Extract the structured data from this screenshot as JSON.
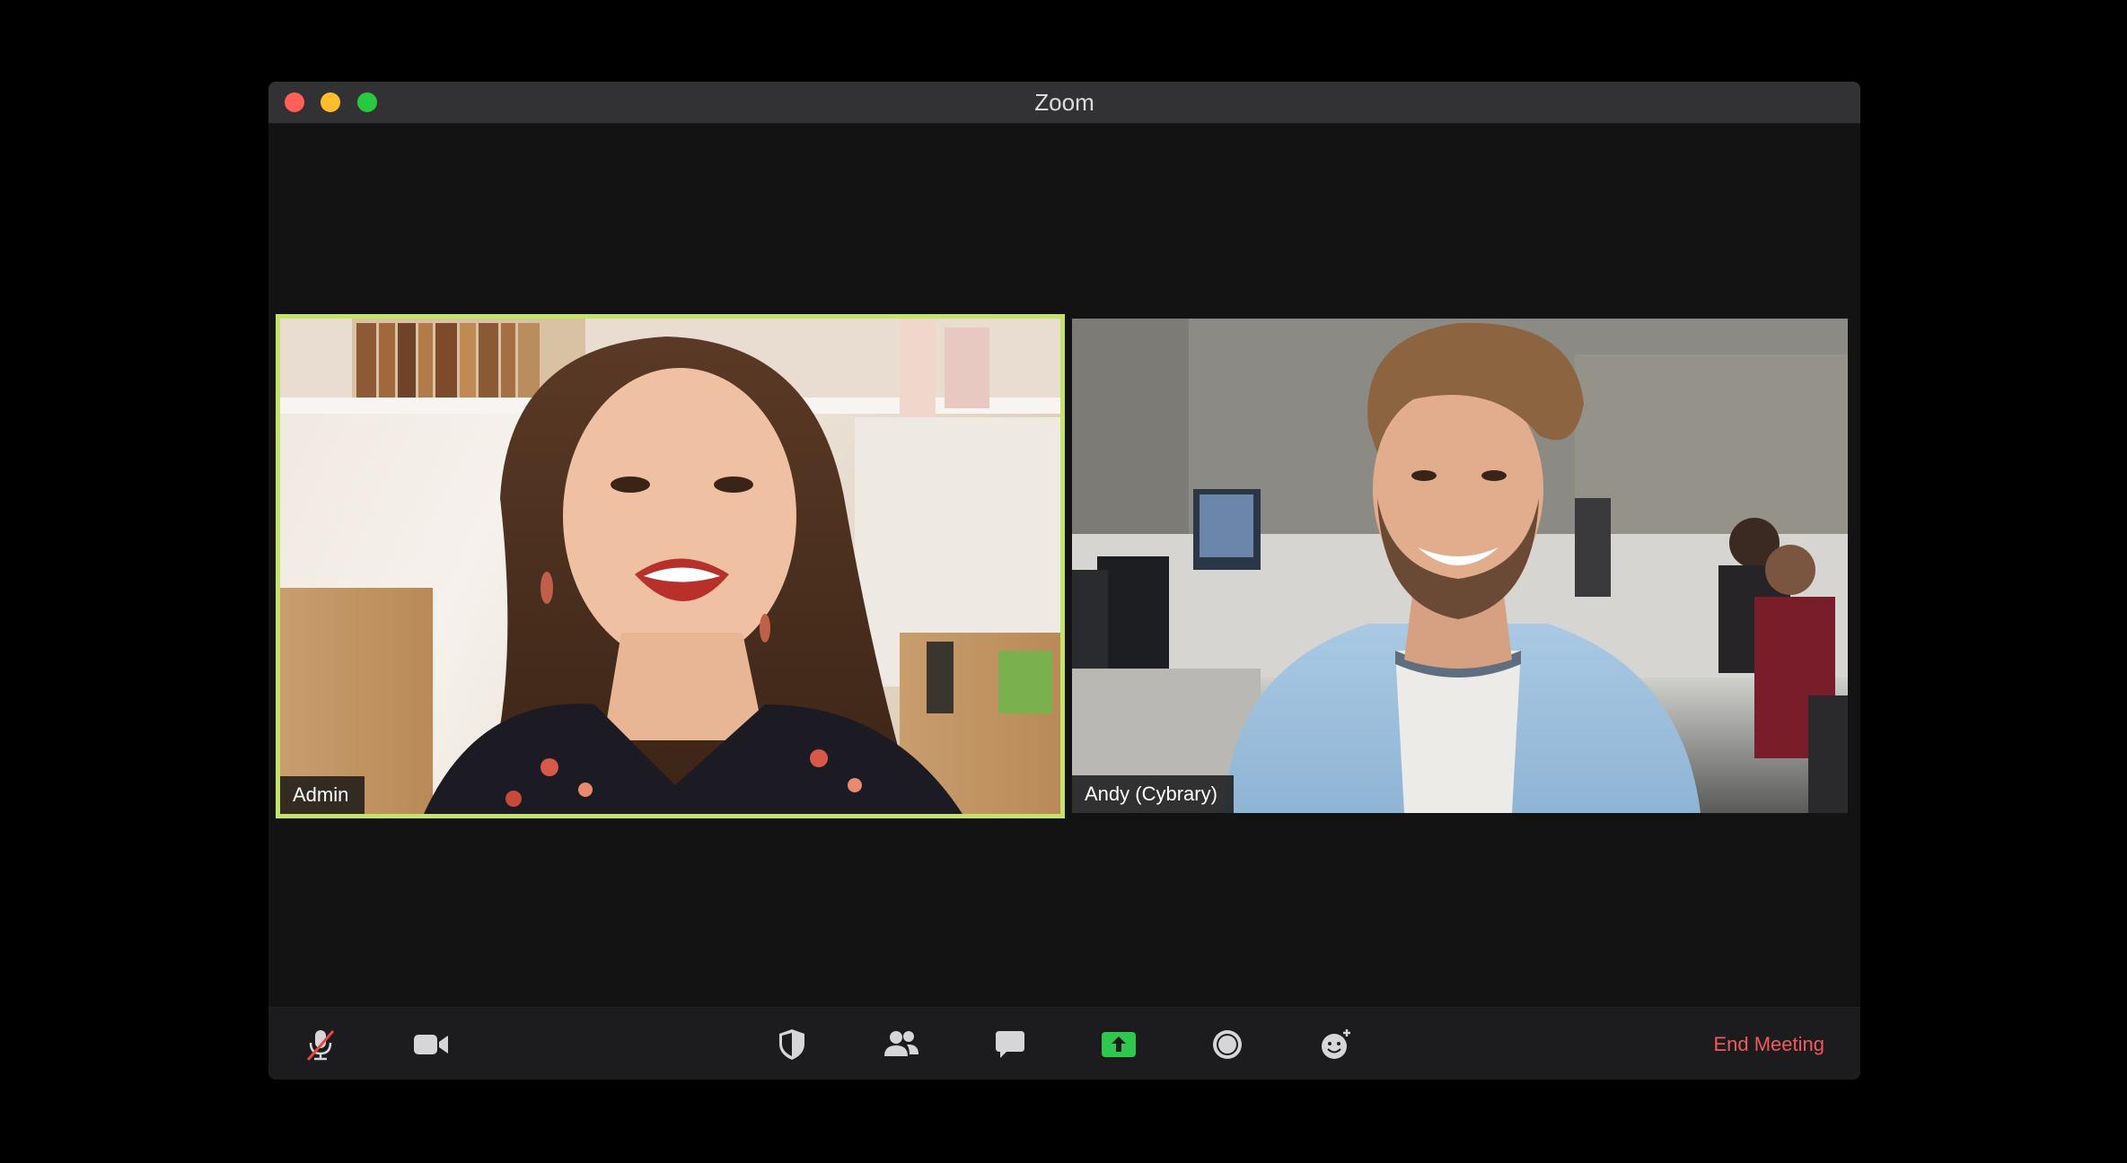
{
  "window": {
    "title": "Zoom"
  },
  "participants": [
    {
      "name": "Admin",
      "active_speaker": true
    },
    {
      "name": "Andy (Cybrary)",
      "active_speaker": false
    }
  ],
  "toolbar": {
    "buttons": [
      {
        "icon": "microphone-muted-icon"
      },
      {
        "icon": "video-camera-icon"
      },
      {
        "icon": "security-shield-icon"
      },
      {
        "icon": "participants-icon"
      },
      {
        "icon": "chat-icon"
      },
      {
        "icon": "share-screen-icon"
      },
      {
        "icon": "record-icon"
      },
      {
        "icon": "reactions-icon"
      }
    ],
    "end_meeting_label": "End Meeting"
  },
  "colors": {
    "active_speaker_border": "#c5e36a",
    "share_green": "#2dc84d",
    "end_meeting_red": "#f2595b",
    "mute_slash_red": "#e8473f"
  }
}
